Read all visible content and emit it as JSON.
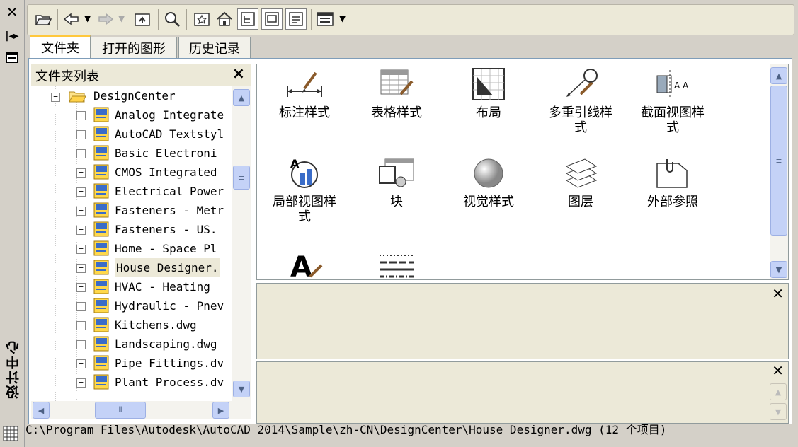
{
  "palette": {
    "title": "设计中心",
    "close_icon": "close-icon",
    "autohide_icon": "autohide-icon",
    "properties_icon": "properties-icon"
  },
  "toolbar": {
    "buttons": [
      "load-folder-icon",
      "back-icon",
      "forward-icon",
      "up-folder-icon",
      "search-icon",
      "favorites-icon",
      "home-icon",
      "tree-toggle-icon",
      "preview-toggle-icon",
      "description-toggle-icon",
      "views-icon"
    ]
  },
  "tabs": [
    "文件夹",
    "打开的图形",
    "历史记录"
  ],
  "tree": {
    "header": "文件夹列表",
    "close": "×",
    "root": "DesignCenter",
    "items": [
      "Analog Integrate",
      "AutoCAD Textstyl",
      "Basic Electroni",
      "CMOS Integrated",
      "Electrical Power",
      "Fasteners - Metr",
      "Fasteners - US.",
      "Home - Space Pl",
      "House Designer.",
      "HVAC - Heating ",
      "Hydraulic - Pnev",
      "Kitchens.dwg",
      "Landscaping.dwg",
      "Pipe Fittings.dv",
      "Plant Process.dv"
    ],
    "selected_index": 8
  },
  "content": {
    "items": [
      {
        "label1": "标注样式",
        "label2": "",
        "icon": "dimstyle-icon"
      },
      {
        "label1": "表格样式",
        "label2": "",
        "icon": "tablestyle-icon"
      },
      {
        "label1": "布局",
        "label2": "",
        "icon": "layout-icon"
      },
      {
        "label1": "多重引线样",
        "label2": "式",
        "icon": "mleaderstyle-icon"
      },
      {
        "label1": "截面视图样",
        "label2": "式",
        "icon": "sectionview-icon"
      },
      {
        "label1": "局部视图样",
        "label2": "式",
        "icon": "detailview-icon"
      },
      {
        "label1": "块",
        "label2": "",
        "icon": "block-icon"
      },
      {
        "label1": "视觉样式",
        "label2": "",
        "icon": "visualstyle-icon"
      },
      {
        "label1": "图层",
        "label2": "",
        "icon": "layer-icon"
      },
      {
        "label1": "外部参照",
        "label2": "",
        "icon": "xref-icon"
      },
      {
        "label1": "",
        "label2": "",
        "icon": "textstyle-icon"
      },
      {
        "label1": "",
        "label2": "",
        "icon": "linetype-icon"
      }
    ]
  },
  "status": {
    "path": "C:\\Program Files\\Autodesk\\AutoCAD 2014\\Sample\\zh-CN\\DesignCenter\\House Designer.dwg (12 个项目)"
  },
  "colors": {
    "accent_tab": "#ffc83c",
    "selection": "#ece9d8",
    "scroll_button": "#c4d2f7"
  }
}
